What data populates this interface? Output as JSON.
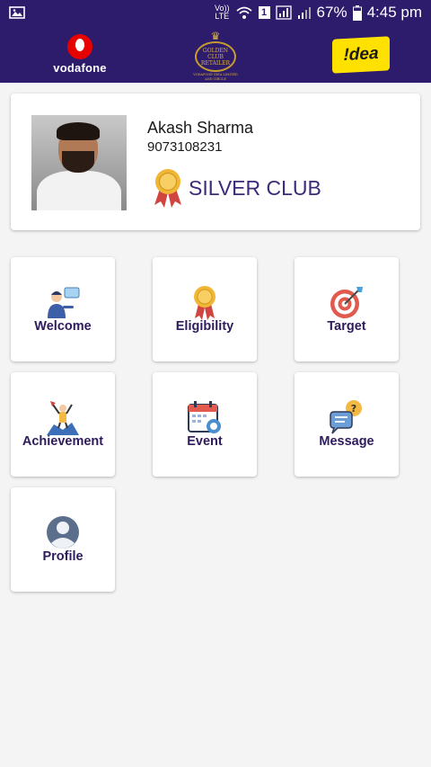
{
  "status_bar": {
    "volte_top": "Vo))",
    "volte_bottom": "LTE",
    "sim_badge": "1",
    "battery_percent": "67%",
    "time": "4:45 pm"
  },
  "header": {
    "vodafone_label": "vodafone",
    "golden_club_line1": "GOLDEN",
    "golden_club_line2": "CLUB",
    "golden_club_line3": "RETAILER",
    "golden_club_sub": "VODAFONE IDEA LIMITED",
    "golden_club_sub2": "AND CIRCLE",
    "idea_label": "!dea"
  },
  "profile": {
    "name": "Akash Sharma",
    "phone": "9073108231",
    "club": "SILVER CLUB"
  },
  "tiles": [
    {
      "label": "Welcome",
      "icon": "welcome-icon"
    },
    {
      "label": "Eligibility",
      "icon": "medal-icon"
    },
    {
      "label": "Target",
      "icon": "target-icon"
    },
    {
      "label": "Achievement",
      "icon": "achievement-icon"
    },
    {
      "label": "Event",
      "icon": "calendar-icon"
    },
    {
      "label": "Message",
      "icon": "message-icon"
    },
    {
      "label": "Profile",
      "icon": "profile-icon"
    }
  ],
  "colors": {
    "header_bg": "#2d1b6b",
    "tile_label": "#2d1b5e",
    "club_text": "#3c2a7a"
  }
}
